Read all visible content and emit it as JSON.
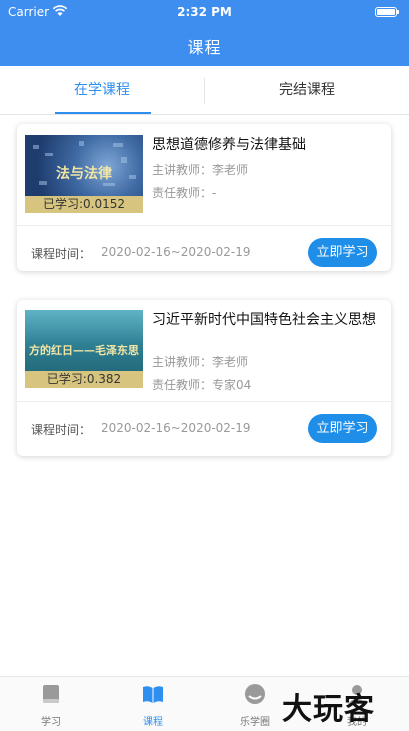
{
  "status_bar": {
    "carrier": "Carrier",
    "time": "2:32 PM"
  },
  "header": {
    "title": "课程"
  },
  "tabs": [
    {
      "label": "在学课程",
      "active": true
    },
    {
      "label": "完结课程",
      "active": false
    }
  ],
  "courses": [
    {
      "thumbnail_text": "法与法律",
      "progress": "已学习:0.0152",
      "title": "思想道德修养与法律基础",
      "lecturer": "主讲教师：李老师",
      "responsible": "责任教师：-",
      "time_label": "课程时间：",
      "time_value": "2020-02-16~2020-02-19",
      "button": "立即学习"
    },
    {
      "thumbnail_text": "方的红日——毛泽东思",
      "progress": "已学习:0.382",
      "title": "习近平新时代中国特色社会主义思想",
      "lecturer": "主讲教师：李老师",
      "responsible": "责任教师：专家04",
      "time_label": "课程时间：",
      "time_value": "2020-02-16~2020-02-19",
      "button": "立即学习"
    }
  ],
  "bottom_nav": [
    {
      "label": "学习",
      "icon": "book-icon",
      "active": false
    },
    {
      "label": "课程",
      "icon": "open-book-icon",
      "active": true
    },
    {
      "label": "乐学圈",
      "icon": "circle-icon",
      "active": false
    },
    {
      "label": "我的",
      "icon": "profile-icon",
      "active": false
    }
  ],
  "watermark": "大玩客",
  "colors": {
    "primary": "#3e8ef0",
    "button": "#1f8ee8",
    "active_text": "#2d8ff0"
  }
}
